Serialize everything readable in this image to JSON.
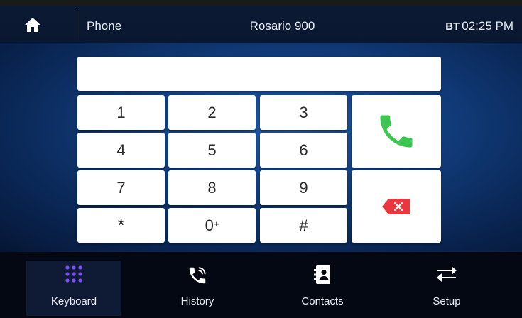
{
  "header": {
    "app_title": "Phone",
    "device_name": "Rosario 900",
    "bt_label": "BT",
    "time": "02:25 PM"
  },
  "dialer": {
    "display_value": "",
    "keys": [
      {
        "label": "1"
      },
      {
        "label": "2"
      },
      {
        "label": "3"
      },
      {
        "label": "4"
      },
      {
        "label": "5"
      },
      {
        "label": "6"
      },
      {
        "label": "7"
      },
      {
        "label": "8"
      },
      {
        "label": "9"
      },
      {
        "label": "*"
      },
      {
        "label": "0",
        "sup": "+"
      },
      {
        "label": "#"
      }
    ],
    "call_icon": "phone-handset-icon",
    "backspace_icon": "backspace-icon"
  },
  "nav": {
    "tabs": [
      {
        "label": "Keyboard",
        "icon": "keypad-grid-icon",
        "active": true
      },
      {
        "label": "History",
        "icon": "phone-ringing-icon",
        "active": false
      },
      {
        "label": "Contacts",
        "icon": "contacts-book-icon",
        "active": false
      },
      {
        "label": "Setup",
        "icon": "swap-arrows-icon",
        "active": false
      }
    ]
  },
  "colors": {
    "call_green": "#3cc651",
    "delete_red": "#e8383d",
    "keypad_accent": "#7b4dff"
  }
}
